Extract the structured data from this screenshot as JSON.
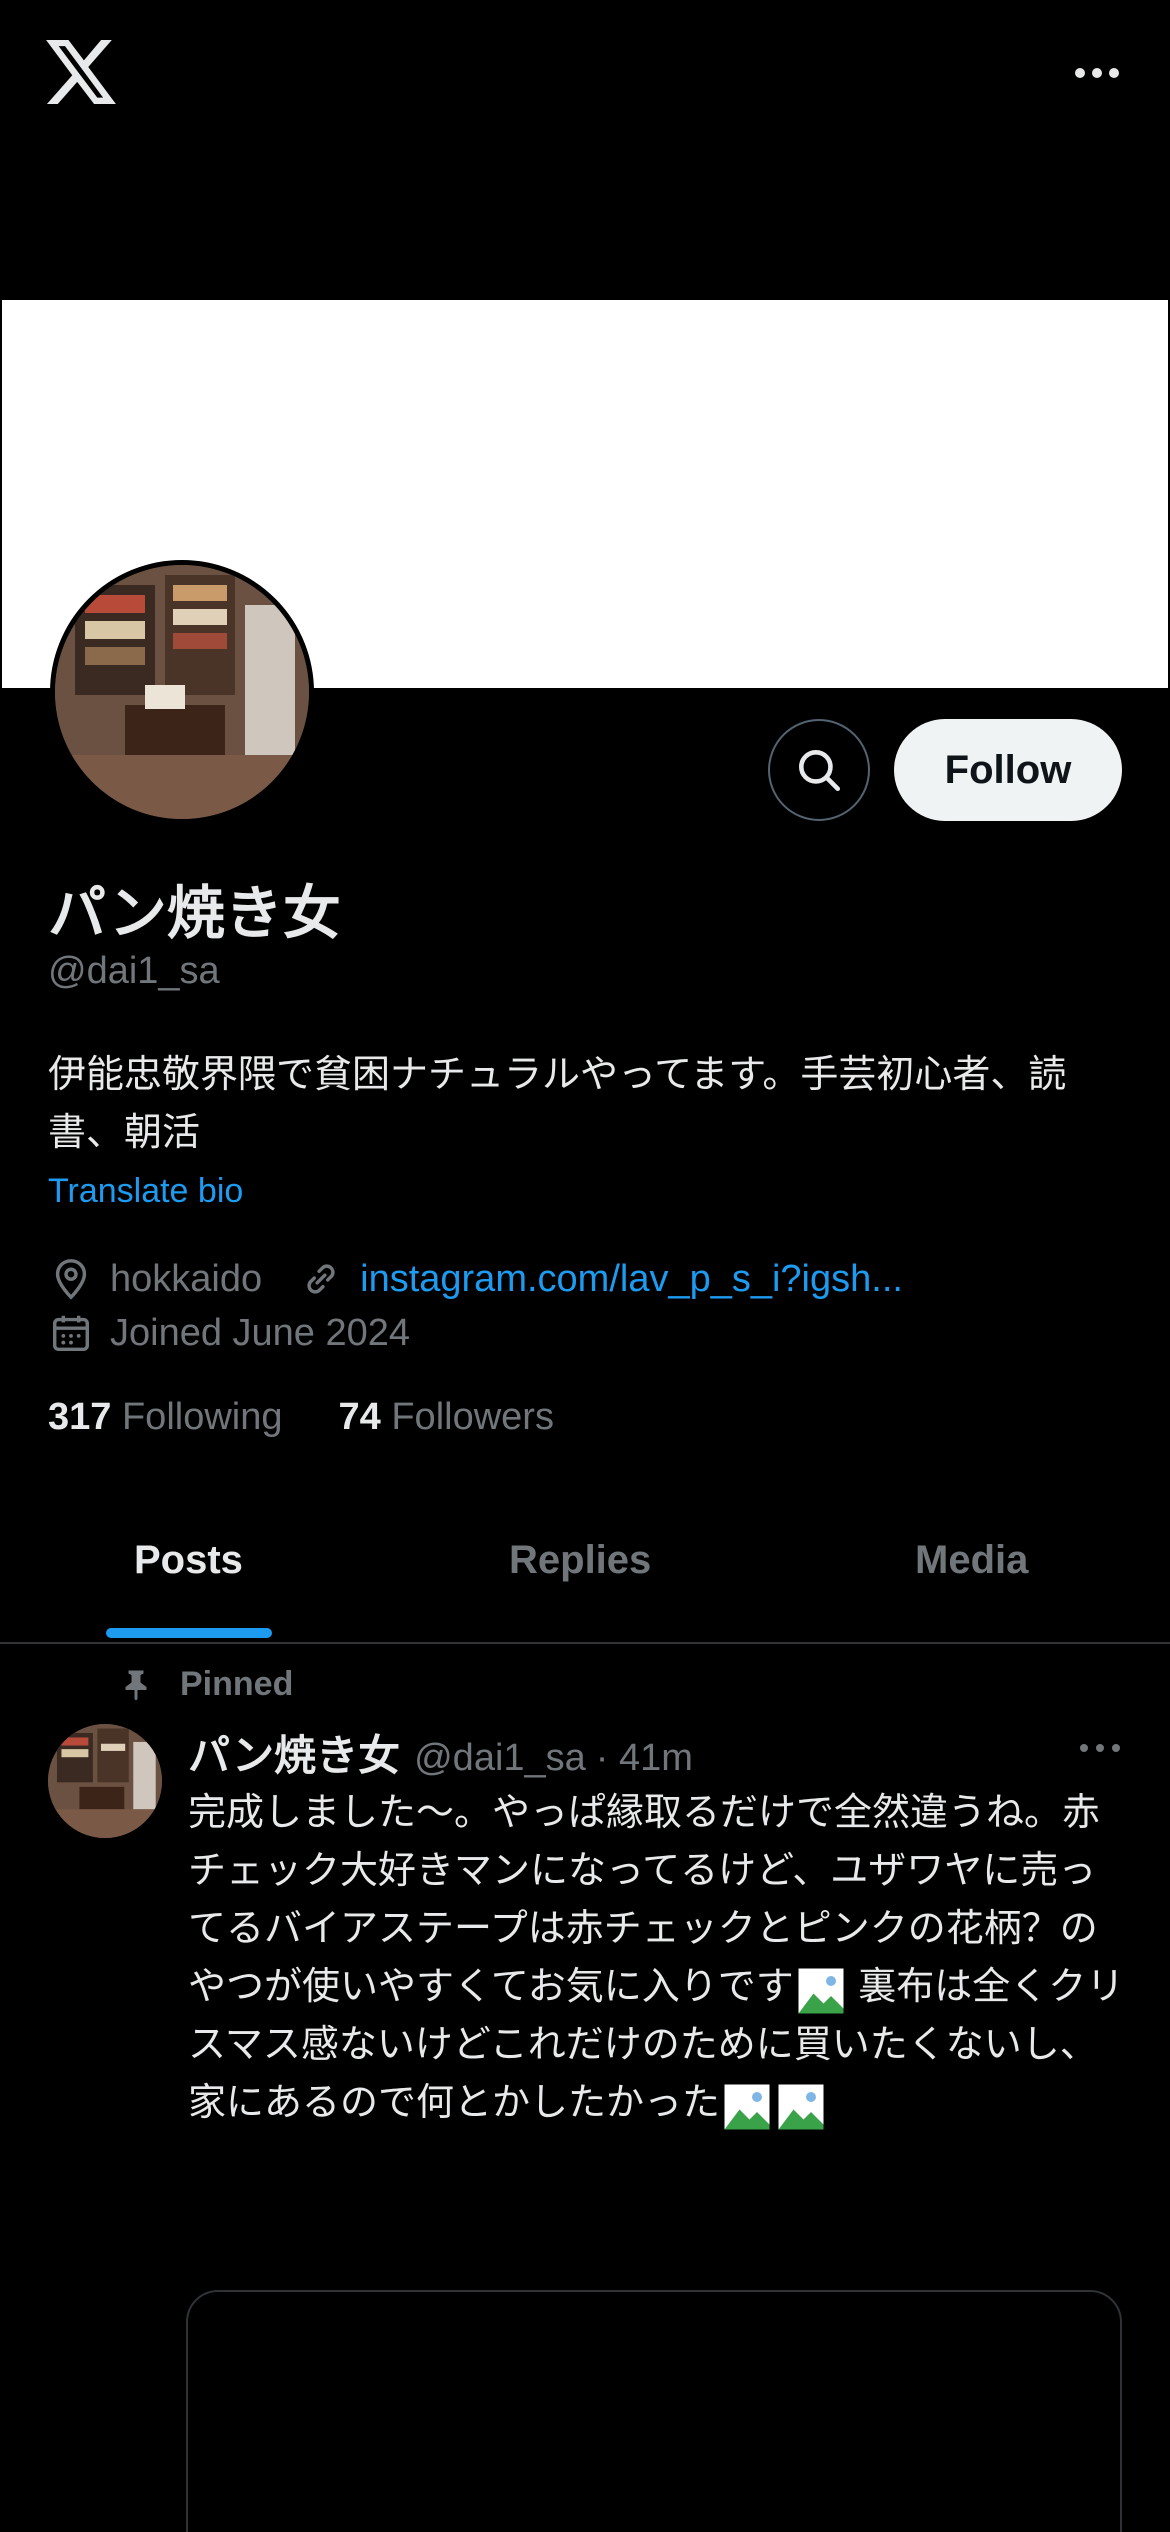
{
  "app": {
    "logo_icon": "x-logo-icon",
    "more_icon": "more-horizontal-icon"
  },
  "profile": {
    "display_name": "パン焼き女",
    "handle": "@dai1_sa",
    "bio": "伊能忠敬界隈で貧困ナチュラルやってます。手芸初心者、読書、朝活",
    "translate_bio": "Translate bio",
    "location": "hokkaido",
    "link": "instagram.com/lav_p_s_i?igsh...",
    "joined": "Joined June 2024",
    "following_count": "317",
    "following_label": "Following",
    "followers_count": "74",
    "followers_label": "Followers",
    "follow_button": "Follow"
  },
  "tabs": [
    {
      "label": "Posts",
      "active": true
    },
    {
      "label": "Replies",
      "active": false
    },
    {
      "label": "Media",
      "active": false
    }
  ],
  "post": {
    "pinned_label": "Pinned",
    "name": "パン焼き女",
    "handle": "@dai1_sa",
    "time": "· 41m",
    "text_part1": "完成しました〜。やっぱ縁取るだけで全然違うね。赤チェック大好きマンになってるけど、ユザワヤに売ってるバイアステープは赤チェックとピンクの花柄？のやつが使いやすくてお気に入りです",
    "text_part2": "裏布は全くクリスマス感ないけどこれだけのために買いたくないし、家にあるので何とかしたかった"
  },
  "colors": {
    "background": "#000000",
    "text": "#e7e9ea",
    "secondary": "#71767b",
    "accent": "#1d9bf0",
    "border": "#2f3336"
  }
}
